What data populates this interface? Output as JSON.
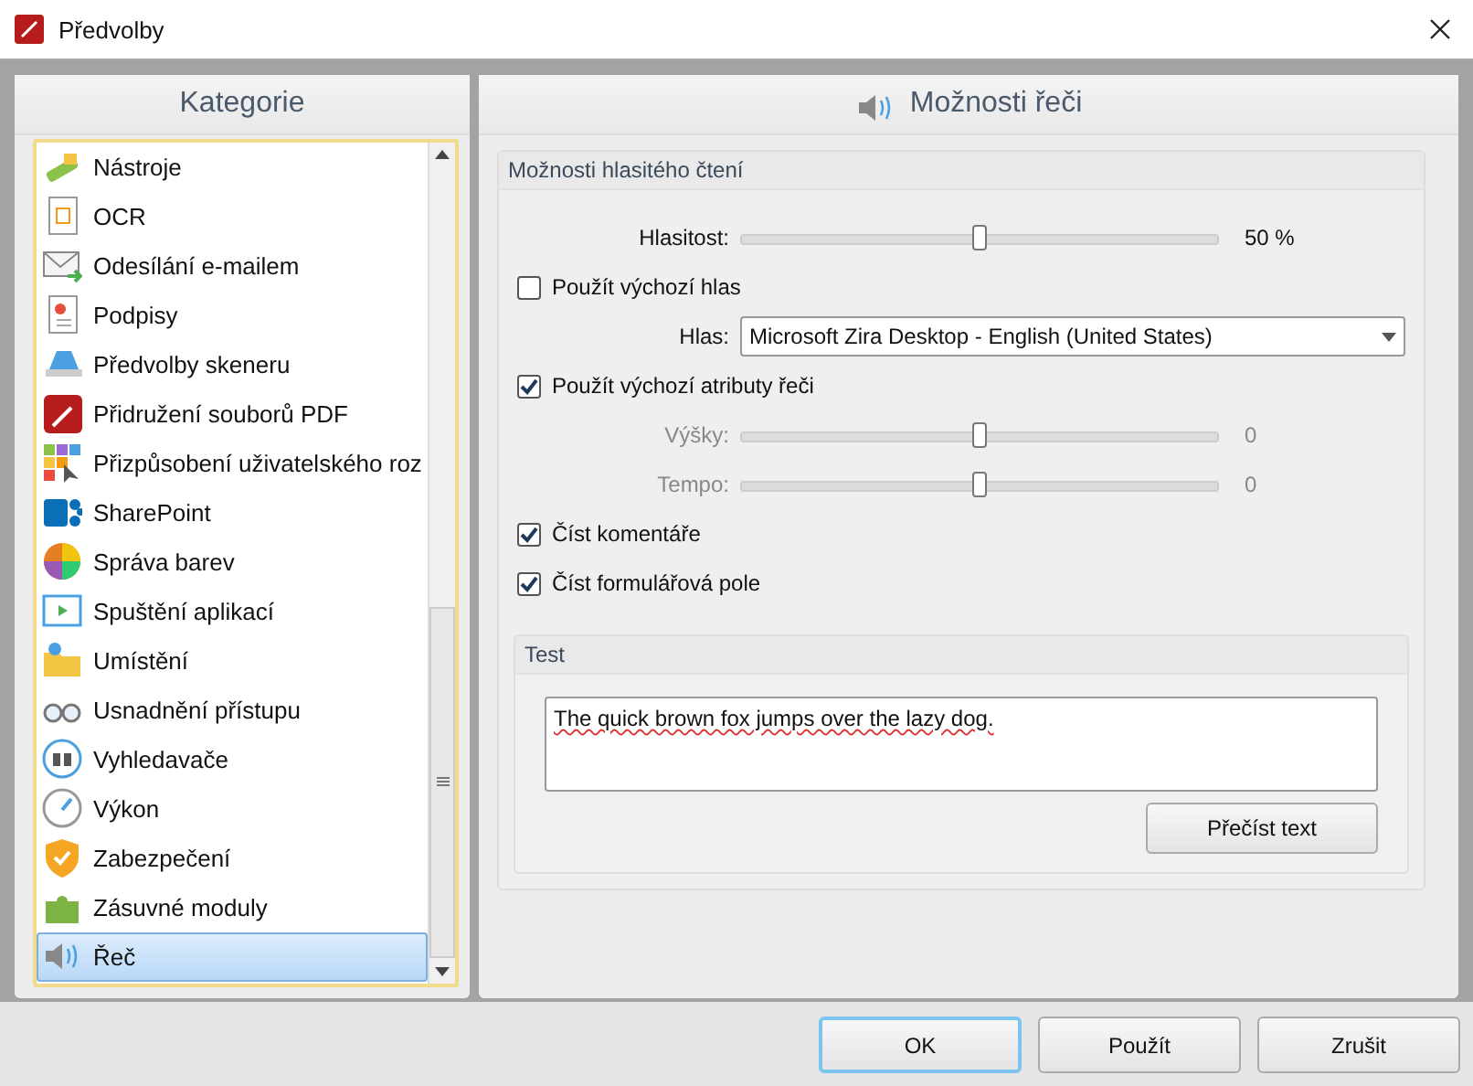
{
  "window": {
    "title": "Předvolby"
  },
  "categories": {
    "title": "Kategorie",
    "items": [
      {
        "label": "Nástroje",
        "selected": false
      },
      {
        "label": "OCR",
        "selected": false
      },
      {
        "label": "Odesílání e-mailem",
        "selected": false
      },
      {
        "label": "Podpisy",
        "selected": false
      },
      {
        "label": "Předvolby skeneru",
        "selected": false
      },
      {
        "label": "Přidružení souborů PDF",
        "selected": false
      },
      {
        "label": "Přizpůsobení uživatelského roz",
        "selected": false
      },
      {
        "label": "SharePoint",
        "selected": false
      },
      {
        "label": "Správa barev",
        "selected": false
      },
      {
        "label": "Spuštění aplikací",
        "selected": false
      },
      {
        "label": "Umístění",
        "selected": false
      },
      {
        "label": "Usnadnění přístupu",
        "selected": false
      },
      {
        "label": "Vyhledavače",
        "selected": false
      },
      {
        "label": "Výkon",
        "selected": false
      },
      {
        "label": "Zabezpečení",
        "selected": false
      },
      {
        "label": "Zásuvné moduly",
        "selected": false
      },
      {
        "label": "Řeč",
        "selected": true
      }
    ]
  },
  "page": {
    "title": "Možnosti řeči",
    "reading": {
      "title": "Možnosti hlasitého čtení",
      "rows": [
        {
          "kind": "slider",
          "label": "Hlasitost:",
          "level": 0.5,
          "reading": "50 %",
          "disabled": false
        },
        {
          "kind": "checkbox",
          "label": "Použít výchozí hlas",
          "checked": false
        },
        {
          "kind": "select",
          "label": "Hlas:",
          "value": "Microsoft Zira Desktop - English (United States)"
        },
        {
          "kind": "checkbox",
          "label": "Použít výchozí atributy řeči",
          "checked": true
        },
        {
          "kind": "slider",
          "label": "Výšky:",
          "level": 0.5,
          "reading": "0",
          "disabled": true
        },
        {
          "kind": "slider",
          "label": "Tempo:",
          "level": 0.5,
          "reading": "0",
          "disabled": true
        },
        {
          "kind": "checkbox",
          "label": "Číst komentáře",
          "checked": true
        },
        {
          "kind": "checkbox",
          "label": "Číst formulářová pole",
          "checked": true
        }
      ]
    },
    "test": {
      "title": "Test",
      "text": "The quick brown fox jumps over the lazy dog.",
      "button": "Přečíst text"
    }
  },
  "buttons": [
    {
      "label": "OK",
      "default": true
    },
    {
      "label": "Použít",
      "default": false
    },
    {
      "label": "Zrušit",
      "default": false
    }
  ]
}
